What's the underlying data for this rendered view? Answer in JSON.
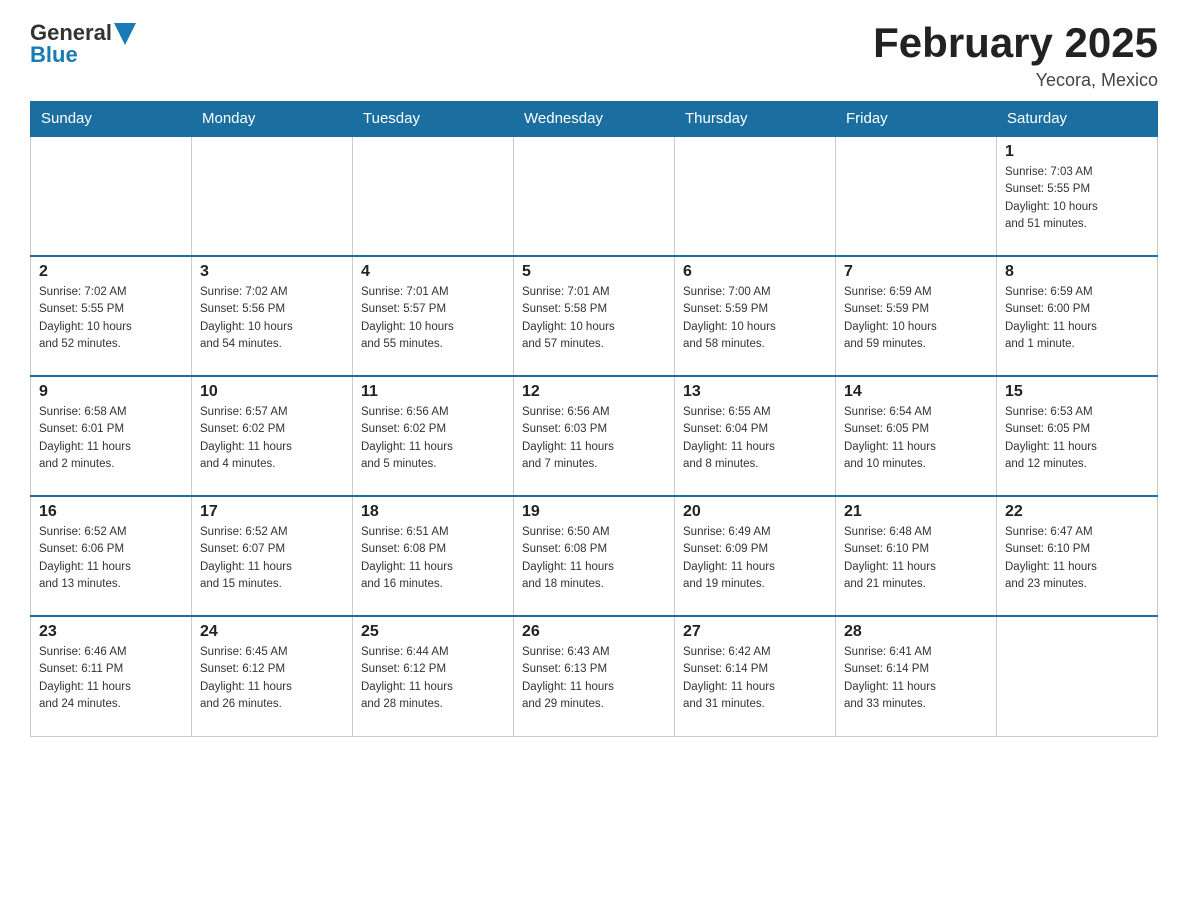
{
  "header": {
    "logo_general": "General",
    "logo_blue": "Blue",
    "title": "February 2025",
    "location": "Yecora, Mexico"
  },
  "days_of_week": [
    "Sunday",
    "Monday",
    "Tuesday",
    "Wednesday",
    "Thursday",
    "Friday",
    "Saturday"
  ],
  "weeks": [
    [
      {
        "day": "",
        "info": ""
      },
      {
        "day": "",
        "info": ""
      },
      {
        "day": "",
        "info": ""
      },
      {
        "day": "",
        "info": ""
      },
      {
        "day": "",
        "info": ""
      },
      {
        "day": "",
        "info": ""
      },
      {
        "day": "1",
        "info": "Sunrise: 7:03 AM\nSunset: 5:55 PM\nDaylight: 10 hours\nand 51 minutes."
      }
    ],
    [
      {
        "day": "2",
        "info": "Sunrise: 7:02 AM\nSunset: 5:55 PM\nDaylight: 10 hours\nand 52 minutes."
      },
      {
        "day": "3",
        "info": "Sunrise: 7:02 AM\nSunset: 5:56 PM\nDaylight: 10 hours\nand 54 minutes."
      },
      {
        "day": "4",
        "info": "Sunrise: 7:01 AM\nSunset: 5:57 PM\nDaylight: 10 hours\nand 55 minutes."
      },
      {
        "day": "5",
        "info": "Sunrise: 7:01 AM\nSunset: 5:58 PM\nDaylight: 10 hours\nand 57 minutes."
      },
      {
        "day": "6",
        "info": "Sunrise: 7:00 AM\nSunset: 5:59 PM\nDaylight: 10 hours\nand 58 minutes."
      },
      {
        "day": "7",
        "info": "Sunrise: 6:59 AM\nSunset: 5:59 PM\nDaylight: 10 hours\nand 59 minutes."
      },
      {
        "day": "8",
        "info": "Sunrise: 6:59 AM\nSunset: 6:00 PM\nDaylight: 11 hours\nand 1 minute."
      }
    ],
    [
      {
        "day": "9",
        "info": "Sunrise: 6:58 AM\nSunset: 6:01 PM\nDaylight: 11 hours\nand 2 minutes."
      },
      {
        "day": "10",
        "info": "Sunrise: 6:57 AM\nSunset: 6:02 PM\nDaylight: 11 hours\nand 4 minutes."
      },
      {
        "day": "11",
        "info": "Sunrise: 6:56 AM\nSunset: 6:02 PM\nDaylight: 11 hours\nand 5 minutes."
      },
      {
        "day": "12",
        "info": "Sunrise: 6:56 AM\nSunset: 6:03 PM\nDaylight: 11 hours\nand 7 minutes."
      },
      {
        "day": "13",
        "info": "Sunrise: 6:55 AM\nSunset: 6:04 PM\nDaylight: 11 hours\nand 8 minutes."
      },
      {
        "day": "14",
        "info": "Sunrise: 6:54 AM\nSunset: 6:05 PM\nDaylight: 11 hours\nand 10 minutes."
      },
      {
        "day": "15",
        "info": "Sunrise: 6:53 AM\nSunset: 6:05 PM\nDaylight: 11 hours\nand 12 minutes."
      }
    ],
    [
      {
        "day": "16",
        "info": "Sunrise: 6:52 AM\nSunset: 6:06 PM\nDaylight: 11 hours\nand 13 minutes."
      },
      {
        "day": "17",
        "info": "Sunrise: 6:52 AM\nSunset: 6:07 PM\nDaylight: 11 hours\nand 15 minutes."
      },
      {
        "day": "18",
        "info": "Sunrise: 6:51 AM\nSunset: 6:08 PM\nDaylight: 11 hours\nand 16 minutes."
      },
      {
        "day": "19",
        "info": "Sunrise: 6:50 AM\nSunset: 6:08 PM\nDaylight: 11 hours\nand 18 minutes."
      },
      {
        "day": "20",
        "info": "Sunrise: 6:49 AM\nSunset: 6:09 PM\nDaylight: 11 hours\nand 19 minutes."
      },
      {
        "day": "21",
        "info": "Sunrise: 6:48 AM\nSunset: 6:10 PM\nDaylight: 11 hours\nand 21 minutes."
      },
      {
        "day": "22",
        "info": "Sunrise: 6:47 AM\nSunset: 6:10 PM\nDaylight: 11 hours\nand 23 minutes."
      }
    ],
    [
      {
        "day": "23",
        "info": "Sunrise: 6:46 AM\nSunset: 6:11 PM\nDaylight: 11 hours\nand 24 minutes."
      },
      {
        "day": "24",
        "info": "Sunrise: 6:45 AM\nSunset: 6:12 PM\nDaylight: 11 hours\nand 26 minutes."
      },
      {
        "day": "25",
        "info": "Sunrise: 6:44 AM\nSunset: 6:12 PM\nDaylight: 11 hours\nand 28 minutes."
      },
      {
        "day": "26",
        "info": "Sunrise: 6:43 AM\nSunset: 6:13 PM\nDaylight: 11 hours\nand 29 minutes."
      },
      {
        "day": "27",
        "info": "Sunrise: 6:42 AM\nSunset: 6:14 PM\nDaylight: 11 hours\nand 31 minutes."
      },
      {
        "day": "28",
        "info": "Sunrise: 6:41 AM\nSunset: 6:14 PM\nDaylight: 11 hours\nand 33 minutes."
      },
      {
        "day": "",
        "info": ""
      }
    ]
  ]
}
